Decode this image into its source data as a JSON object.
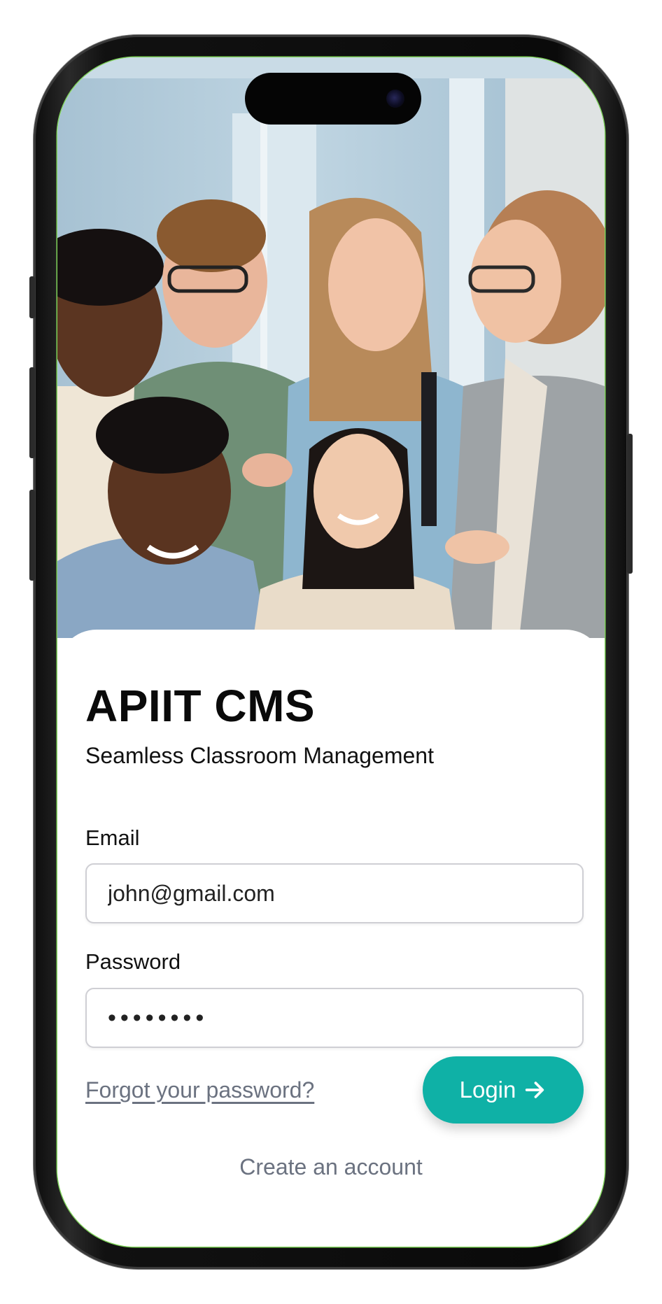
{
  "app": {
    "title": "APIIT CMS",
    "subtitle": "Seamless Classroom Management"
  },
  "form": {
    "email_label": "Email",
    "email_value": "john@gmail.com",
    "password_label": "Password",
    "password_value": "••••••••"
  },
  "actions": {
    "forgot_label": "Forgot your password?",
    "login_label": "Login",
    "create_label": "Create an account"
  },
  "icons": {
    "login": "arrow-right-icon"
  },
  "colors": {
    "accent": "#0fb1a6",
    "link": "#6b7280",
    "title": "#0a0a0a"
  }
}
